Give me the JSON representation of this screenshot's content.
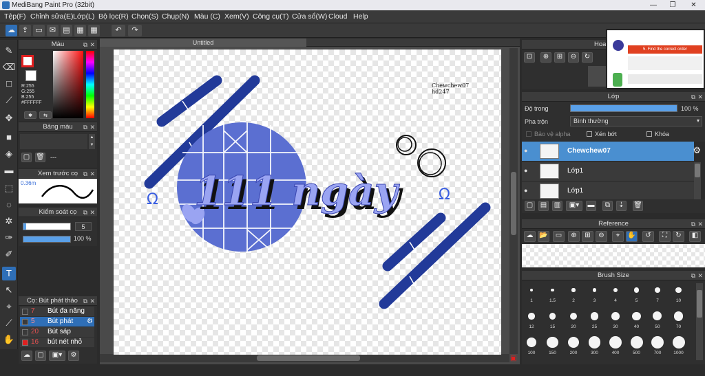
{
  "app": {
    "title": "MediBang Paint Pro (32bit)"
  },
  "menu": [
    "Tệp(F)",
    "Chỉnh sửa(E)",
    "Lớp(L)",
    "Bộ lọc(R)",
    "Chọn(S)",
    "Chụp(N)",
    "Màu (C)",
    "Xem(V)",
    "Công cụ(T)",
    "Cửa sổ(W)",
    "Cloud",
    "Help"
  ],
  "color_panel": {
    "title": "Màu",
    "r": "R:255",
    "g": "G:255",
    "b": "B:255",
    "hex": "#FFFFFF"
  },
  "palette_panel": {
    "title": "Bảng màu",
    "placeholder": "---"
  },
  "preview_panel": {
    "title": "Xem trước cọ",
    "size": "0.36m"
  },
  "brush_control": {
    "title": "Kiểm soát cọ",
    "size_value": "5",
    "opacity_value": "100 %",
    "opacity": 1.0
  },
  "brush_panel": {
    "title": "Cọ: Bút phát thảo",
    "items": [
      {
        "size": "7",
        "name": "Bút đa năng",
        "swatch": "#3a3a3a",
        "selected": false
      },
      {
        "size": "5",
        "name": "Bút phát",
        "swatch": "#3a3a3a",
        "selected": true
      },
      {
        "size": "20",
        "name": "Bút sáp",
        "swatch": "#3a3a3a",
        "selected": false
      },
      {
        "size": "16",
        "name": "bút nét nhỏ",
        "swatch": "#e02020",
        "selected": false
      }
    ]
  },
  "document": {
    "tab": "Untitled"
  },
  "artwork": {
    "watermark_line1": "Chewchew07",
    "watermark_line2": "hd247",
    "main_text": "111 ngày",
    "omega": "Ω"
  },
  "navigator": {
    "title": "Hoa"
  },
  "layer_panel": {
    "title": "Lớp",
    "opacity_label": "Độ trong",
    "opacity_value": "100 %",
    "opacity": 1.0,
    "blend_label": "Pha trộn",
    "blend_value": "Bình thường",
    "protect_alpha": "Bảo vệ alpha",
    "clipping": "Xén bớt",
    "lock": "Khóa",
    "layers": [
      {
        "name": "Chewchew07",
        "selected": true
      },
      {
        "name": "Lớp1",
        "selected": false
      },
      {
        "name": "Lớp1",
        "selected": false
      }
    ]
  },
  "reference_panel": {
    "title": "Reference"
  },
  "brush_size_panel": {
    "title": "Brush Size",
    "sizes": [
      "1",
      "1.5",
      "2",
      "3",
      "4",
      "5",
      "7",
      "10",
      "12",
      "15",
      "20",
      "25",
      "30",
      "40",
      "50",
      "70",
      "100",
      "150",
      "200",
      "300",
      "400",
      "500",
      "700",
      "1000"
    ]
  },
  "screenshot_thumb": {
    "heading": "5. Find the correct order"
  },
  "colors": {
    "accent": "#2f6fb7",
    "shape": "#223a99",
    "circle": "#5b6fd1",
    "text_light": "#9aa4f2"
  }
}
